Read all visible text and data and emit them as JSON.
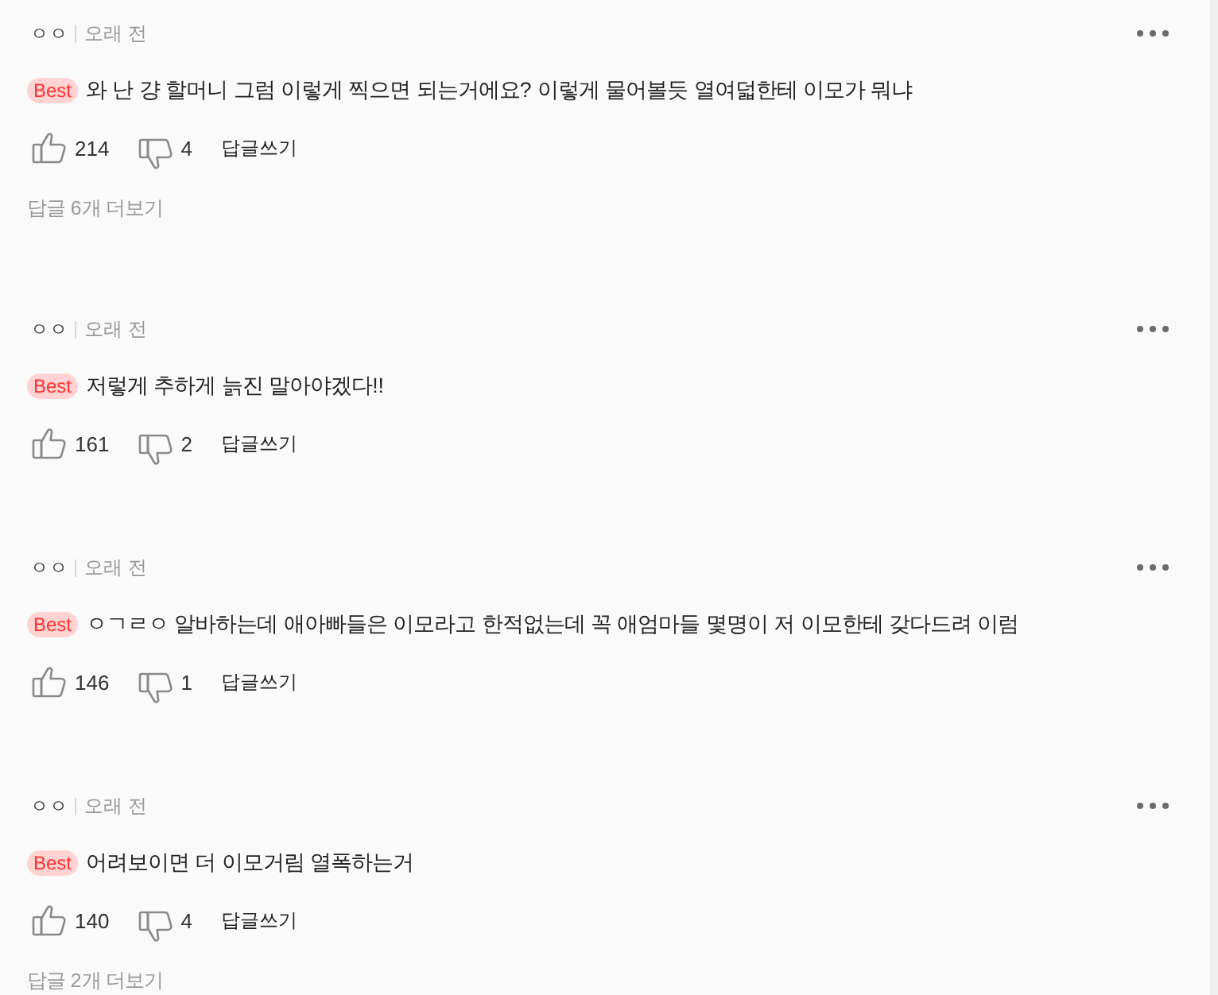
{
  "comments": [
    {
      "author": "ㅇㅇ",
      "time": "오래 전",
      "badge": "Best",
      "text": "와 난 걍 할머니 그럼 이렇게 찍으면 되는거에요? 이렇게 물어볼듯 열여덟한테 이모가 뭐냐",
      "likes": "214",
      "dislikes": "4",
      "reply_action": "답글쓰기",
      "replies_link": "답글 6개 더보기"
    },
    {
      "author": "ㅇㅇ",
      "time": "오래 전",
      "badge": "Best",
      "text": "저렇게 추하게 늙진 말아야겠다!!",
      "likes": "161",
      "dislikes": "2",
      "reply_action": "답글쓰기"
    },
    {
      "author": "ㅇㅇ",
      "time": "오래 전",
      "badge": "Best",
      "text": "ㅇㄱㄹㅇ 알바하는데 애아빠들은 이모라고 한적없는데 꼭 애엄마들 몇명이 저 이모한테 갖다드려 이럼",
      "likes": "146",
      "dislikes": "1",
      "reply_action": "답글쓰기"
    },
    {
      "author": "ㅇㅇ",
      "time": "오래 전",
      "badge": "Best",
      "text": "어려보이면 더 이모거림 열폭하는거",
      "likes": "140",
      "dislikes": "4",
      "reply_action": "답글쓰기",
      "replies_link": "답글 2개 더보기"
    }
  ]
}
